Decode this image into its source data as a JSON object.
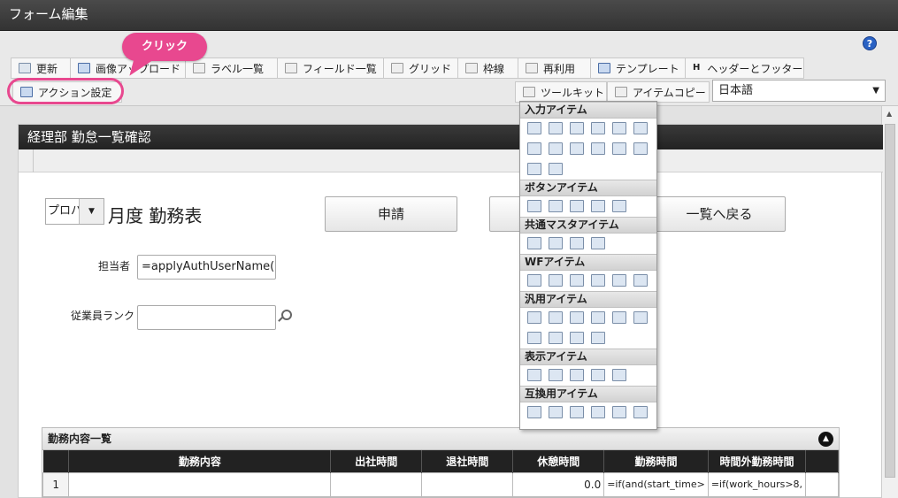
{
  "window": {
    "title": "フォーム編集",
    "help": "?"
  },
  "toolbar": {
    "tabs": [
      {
        "label": "更新",
        "icon": "refresh-icon"
      },
      {
        "label": "画像アップロード",
        "icon": "image-upload-icon"
      },
      {
        "label": "ラベル一覧",
        "icon": "label-list-icon"
      },
      {
        "label": "フィールド一覧",
        "icon": "field-list-icon"
      },
      {
        "label": "グリッド",
        "icon": "grid-icon"
      },
      {
        "label": "枠線",
        "icon": "border-icon"
      },
      {
        "label": "再利用",
        "icon": "reuse-icon"
      },
      {
        "label": "テンプレート",
        "icon": "template-icon"
      },
      {
        "label": "ヘッダーとフッター",
        "icon": "header-footer-icon",
        "glyph": "H"
      }
    ],
    "action": "アクション設定",
    "toolkit": "ツールキット",
    "item_copy": "アイテムコピー",
    "language": "日本語"
  },
  "callout": {
    "text": "クリック",
    "color": "#e8488f"
  },
  "form": {
    "title": "経理部 勤怠一覧確認",
    "period_select": "プロパ",
    "heading": "月度 勤務表",
    "buttons": {
      "apply": "申請",
      "back": "一覧へ戻る"
    },
    "labels": {
      "person": "担当者",
      "rank": "従業員ランク"
    },
    "inputs": {
      "person_value": "=applyAuthUserName()",
      "rank_value": ""
    }
  },
  "grid": {
    "title": "勤務内容一覧",
    "columns": [
      "",
      "勤務内容",
      "出社時間",
      "退社時間",
      "休憩時間",
      "勤務時間",
      "時間外勤務時間"
    ],
    "rows": [
      [
        "1",
        "",
        "",
        "",
        "0.0",
        "=if(and(start_time>",
        "=if(work_hours>8,"
      ]
    ]
  },
  "palette": {
    "sections": [
      {
        "title": "入力アイテム",
        "rows": [
          6,
          6,
          2
        ]
      },
      {
        "title": "ボタンアイテム",
        "rows": [
          5
        ]
      },
      {
        "title": "共通マスタアイテム",
        "rows": [
          4
        ]
      },
      {
        "title": "WFアイテム",
        "rows": [
          6
        ]
      },
      {
        "title": "汎用アイテム",
        "rows": [
          6,
          4
        ]
      },
      {
        "title": "表示アイテム",
        "rows": [
          5
        ]
      },
      {
        "title": "互換用アイテム",
        "rows": [
          6
        ]
      }
    ]
  }
}
